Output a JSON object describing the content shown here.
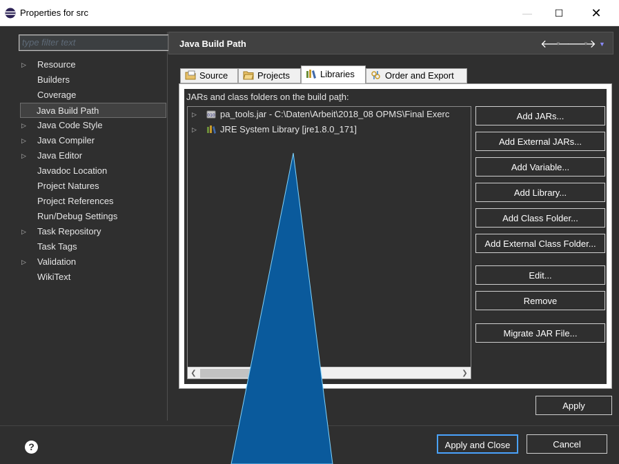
{
  "window": {
    "title": "Properties for src",
    "minimize_label": "—",
    "maximize_label": "☐",
    "close_label": "✕"
  },
  "sidebar": {
    "filter_placeholder": "type filter text",
    "items": [
      {
        "label": "Resource",
        "expandable": true
      },
      {
        "label": "Builders",
        "expandable": false
      },
      {
        "label": "Coverage",
        "expandable": false
      },
      {
        "label": "Java Build Path",
        "expandable": false,
        "selected": true
      },
      {
        "label": "Java Code Style",
        "expandable": true
      },
      {
        "label": "Java Compiler",
        "expandable": true
      },
      {
        "label": "Java Editor",
        "expandable": true
      },
      {
        "label": "Javadoc Location",
        "expandable": false
      },
      {
        "label": "Project Natures",
        "expandable": false
      },
      {
        "label": "Project References",
        "expandable": false
      },
      {
        "label": "Run/Debug Settings",
        "expandable": false
      },
      {
        "label": "Task Repository",
        "expandable": true
      },
      {
        "label": "Task Tags",
        "expandable": false
      },
      {
        "label": "Validation",
        "expandable": true
      },
      {
        "label": "WikiText",
        "expandable": false
      }
    ]
  },
  "page": {
    "title": "Java Build Path"
  },
  "tabs": [
    {
      "label": "Source",
      "icon": "source-folder-icon"
    },
    {
      "label": "Projects",
      "icon": "projects-folder-icon"
    },
    {
      "label": "Libraries",
      "icon": "libraries-icon",
      "active": true
    },
    {
      "label": "Order and Export",
      "icon": "order-export-icon"
    }
  ],
  "libraries": {
    "label_prefix": "JARs and class folders on the build pa",
    "label_mnemonic": "t",
    "label_suffix": "h:",
    "entries": [
      {
        "label": "pa_tools.jar - C:\\Daten\\Arbeit\\2018_08 OPMS\\Final Exerc",
        "icon": "jar-icon"
      },
      {
        "label": "JRE System Library [jre1.8.0_171]",
        "icon": "jre-library-icon"
      }
    ]
  },
  "buttons": {
    "add_jars": "Add JARs...",
    "add_external_jars": "Add External JARs...",
    "add_variable": "Add Variable...",
    "add_library": "Add Library...",
    "add_class_folder": "Add Class Folder...",
    "add_external_class_folder": "Add External Class Folder...",
    "edit": "Edit...",
    "remove": "Remove",
    "migrate_jar": "Migrate JAR File...",
    "apply": "Apply",
    "apply_and_close": "Apply and Close",
    "cancel": "Cancel"
  },
  "colors": {
    "dialog_bg": "#2f2f2f",
    "overlay_fill": "#0a5a9c"
  }
}
